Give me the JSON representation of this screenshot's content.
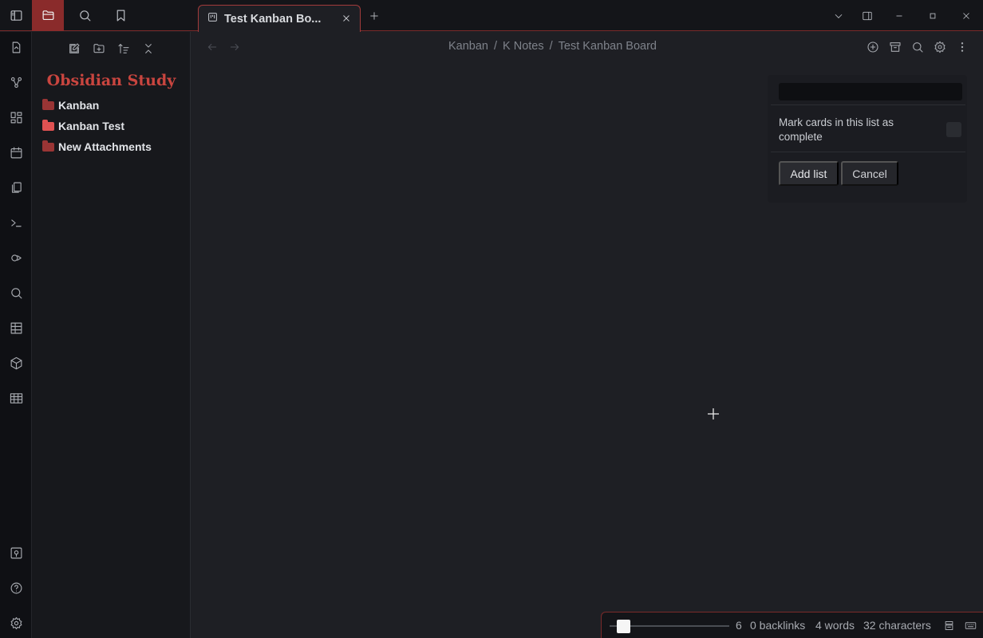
{
  "tabs": [
    {
      "title": "Test Kanban Bo...",
      "icon": "kanban-board-icon"
    }
  ],
  "sidebar": {
    "vault_name": "Obsidian Study",
    "folders": [
      {
        "label": "Kanban"
      },
      {
        "label": "Kanban Test"
      },
      {
        "label": "New Attachments"
      }
    ]
  },
  "breadcrumb": {
    "parts": [
      "Kanban",
      "K Notes",
      "Test Kanban Board"
    ],
    "separator": "/"
  },
  "add_list_form": {
    "title_value": "",
    "mark_complete_label": "Mark cards in this list as complete",
    "mark_complete_checked": false,
    "add_button": "Add list",
    "cancel_button": "Cancel"
  },
  "status_bar": {
    "slider_value": "6",
    "backlinks": "0 backlinks",
    "words": "4 words",
    "characters": "32 characters"
  },
  "colors": {
    "accent": "#a23b3b",
    "vault_title": "#c9453f",
    "background": "#1e1f24"
  }
}
